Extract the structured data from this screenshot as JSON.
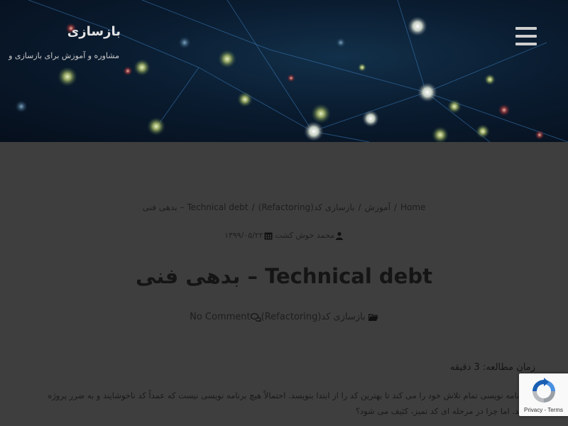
{
  "site": {
    "title": "بازسازی",
    "description": "مشاوره و آموزش برای بازسازی و"
  },
  "icons": {
    "menu": "hamburger-menu-icon",
    "author": "user-icon",
    "date": "calendar-icon",
    "category": "folder-open-icon",
    "comments": "comments-icon",
    "recaptcha": "recaptcha-logo-icon"
  },
  "breadcrumb": {
    "items": [
      "Home",
      "آموزش",
      "بازسازی کد(Refactoring)",
      "Technical debt – بدهی فنی"
    ],
    "separator": "/"
  },
  "meta": {
    "author": "محمد خوش کشت",
    "date": "۱۳۹۹/۰۵/۲۲"
  },
  "post": {
    "title": "Technical debt – بدهی فنی",
    "category": "بازسازی کد(Refactoring)",
    "comments": "No Comment",
    "reading_time": "زمان مطالعه: 3 دقیقه",
    "body": "هر برنامه نویسی تمام تلاش خود را می کند تا بهترین کد را از ابتدا بنویسد. احتمالاً هیچ برنامه نویسی نیست که عمداً کد ناخوشایند و به ضرر پروژه بنویسد. اما چرا در مرحله ای کد تمیز، کثیف می شود؟"
  },
  "recaptcha": {
    "privacy": "Privacy",
    "separator": "-",
    "terms": "Terms"
  },
  "colors": {
    "page_bg": "#3e3e3e",
    "header_bg": "#0a1c30",
    "node_glow": "#d6e4c8"
  }
}
